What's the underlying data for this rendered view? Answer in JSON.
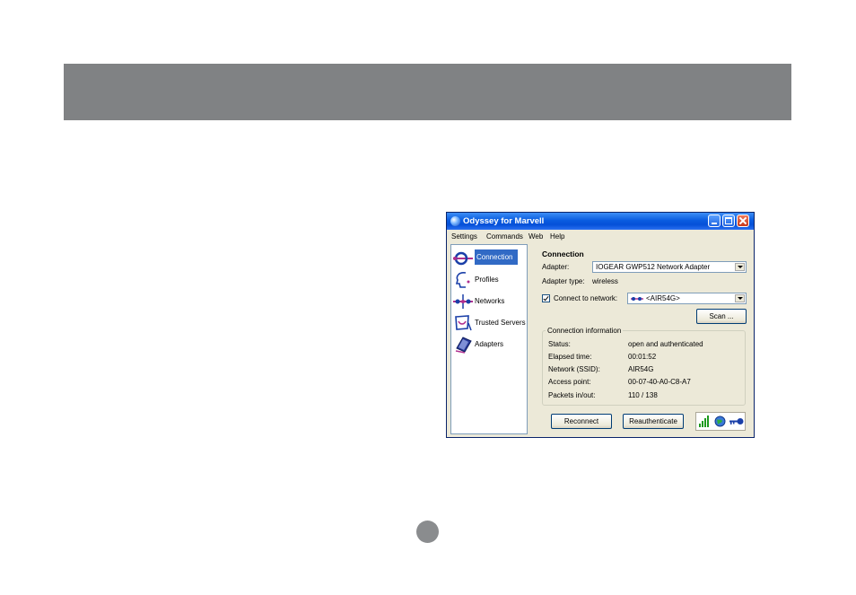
{
  "window": {
    "title": "Odyssey for Marvell",
    "title_bar_color": "#0a5ce0"
  },
  "menu": [
    "Settings",
    "Commands",
    "Web",
    "Help"
  ],
  "sidebar": {
    "items": [
      {
        "label": "Connection",
        "icon": "connection-icon",
        "active": true
      },
      {
        "label": "Profiles",
        "icon": "profiles-icon",
        "active": false
      },
      {
        "label": "Networks",
        "icon": "networks-icon",
        "active": false
      },
      {
        "label": "Trusted Servers",
        "icon": "trusted-servers-icon",
        "active": false
      },
      {
        "label": "Adapters",
        "icon": "adapters-icon",
        "active": false
      }
    ],
    "active_color": "#316ac5"
  },
  "connection": {
    "heading": "Connection",
    "adapter_label": "Adapter:",
    "adapter_value": "IOGEAR GWP512 Network Adapter",
    "adapter_type_label": "Adapter type:",
    "adapter_type_value": "wireless",
    "connect_label": "Connect to network:",
    "connect_checked": true,
    "network_value": "<AIR54G>",
    "scan_button": "Scan ..."
  },
  "info": {
    "title": "Connection information",
    "rows": [
      {
        "label": "Status:",
        "value": "open and authenticated"
      },
      {
        "label": "Elapsed time:",
        "value": "00:01:52"
      },
      {
        "label": "Network (SSID):",
        "value": "AIR54G"
      },
      {
        "label": "Access point:",
        "value": "00-07-40-A0-C8-A7"
      },
      {
        "label": "Packets in/out:",
        "value": "110 / 138"
      }
    ]
  },
  "buttons": {
    "reconnect": "Reconnect",
    "reauthenticate": "Reauthenticate"
  },
  "status_icons": [
    "signal-strength-icon",
    "globe-icon",
    "key-icon"
  ],
  "page": {
    "header_bar_color": "#808284"
  }
}
